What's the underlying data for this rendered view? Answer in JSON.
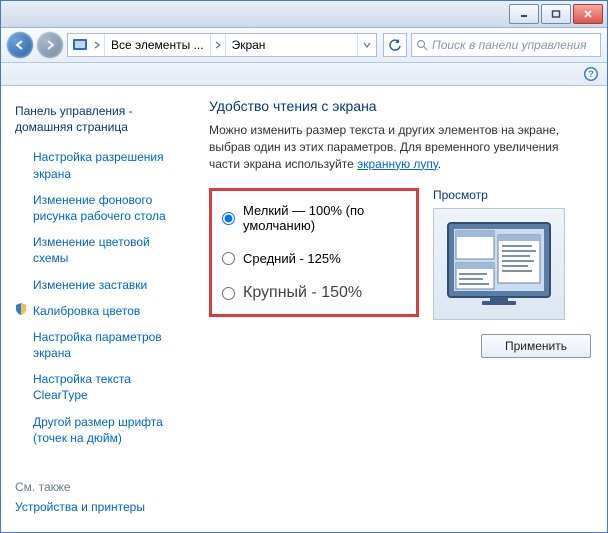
{
  "window": {
    "minimize": "_",
    "maximize": "□",
    "close": "×"
  },
  "nav": {
    "crumb1": "Все элементы ...",
    "crumb2": "Экран",
    "search_placeholder": "Поиск в панели управления"
  },
  "sidebar": {
    "home": "Панель управления - домашняя страница",
    "links": [
      "Настройка разрешения экрана",
      "Изменение фонового рисунка рабочего стола",
      "Изменение цветовой схемы",
      "Изменение заставки",
      "Калибровка цветов",
      "Настройка параметров экрана",
      "Настройка текста ClearType",
      "Другой размер шрифта (точек на дюйм)"
    ],
    "shield_index": 4,
    "seealso_label": "См. также",
    "seealso": [
      "Устройства и принтеры"
    ]
  },
  "content": {
    "title": "Удобство чтения с экрана",
    "desc1": "Можно изменить размер текста и других элементов на экране, выбрав один из этих параметров. Для временного увеличения части экрана используйте ",
    "desc_link": "экранную лупу",
    "desc2": ".",
    "options": [
      {
        "label": "Мелкий — 100% (по умолчанию)",
        "checked": true
      },
      {
        "label": "Средний - 125%",
        "checked": false
      },
      {
        "label": "Крупный - 150%",
        "checked": false
      }
    ],
    "preview_label": "Просмотр",
    "apply": "Применить"
  }
}
